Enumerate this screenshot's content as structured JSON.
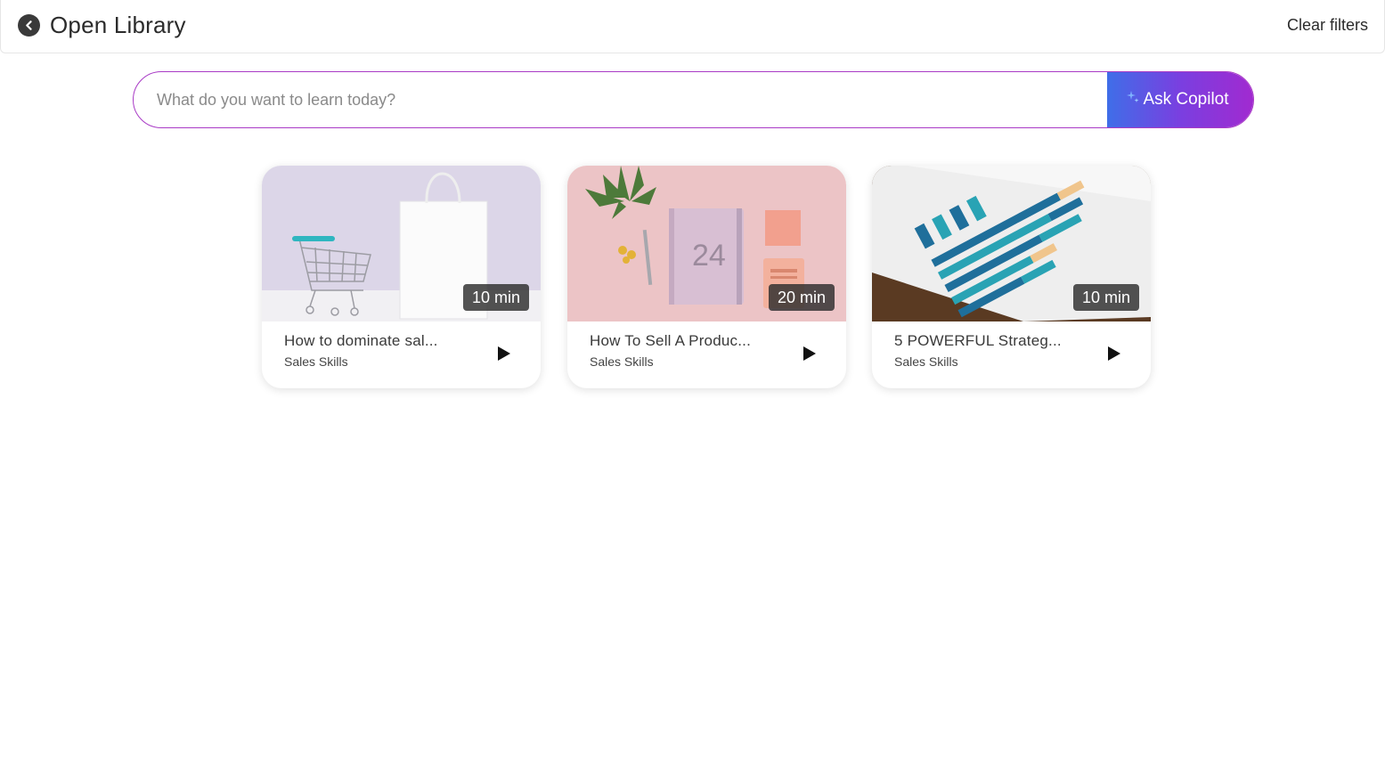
{
  "header": {
    "title": "Open Library",
    "back_icon": "chevron-left-icon",
    "clear_filters_label": "Clear filters"
  },
  "search": {
    "placeholder": "What do you want to learn today?",
    "value": "",
    "button_label": "Ask Copilot",
    "button_icon": "sparkle-icon",
    "border_color": "#a93bc6",
    "button_gradient": [
      "#3f6ee8",
      "#7a3fe0",
      "#a12ad0"
    ]
  },
  "courses": [
    {
      "title": "How to dominate sal...",
      "category": "Sales Skills",
      "duration": "10 min",
      "thumbnail": "shopping-cart-and-bag"
    },
    {
      "title": "How To Sell A Produc...",
      "category": "Sales Skills",
      "duration": "20 min",
      "thumbnail": "notebook-on-pink-desk"
    },
    {
      "title": "5 POWERFUL Strateg...",
      "category": "Sales Skills",
      "duration": "10 min",
      "thumbnail": "bar-chart-report"
    }
  ]
}
